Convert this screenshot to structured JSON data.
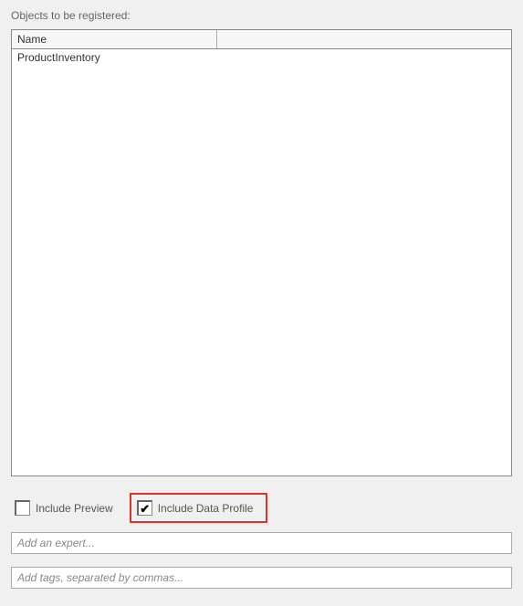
{
  "section_label": "Objects to be registered:",
  "table": {
    "columns": [
      "Name"
    ],
    "rows": [
      {
        "name": "ProductInventory"
      }
    ]
  },
  "checkboxes": {
    "include_preview": {
      "label": "Include Preview",
      "checked": false
    },
    "include_data_profile": {
      "label": "Include Data Profile",
      "checked": true
    }
  },
  "inputs": {
    "expert_placeholder": "Add an expert...",
    "tags_placeholder": "Add tags, separated by commas..."
  }
}
